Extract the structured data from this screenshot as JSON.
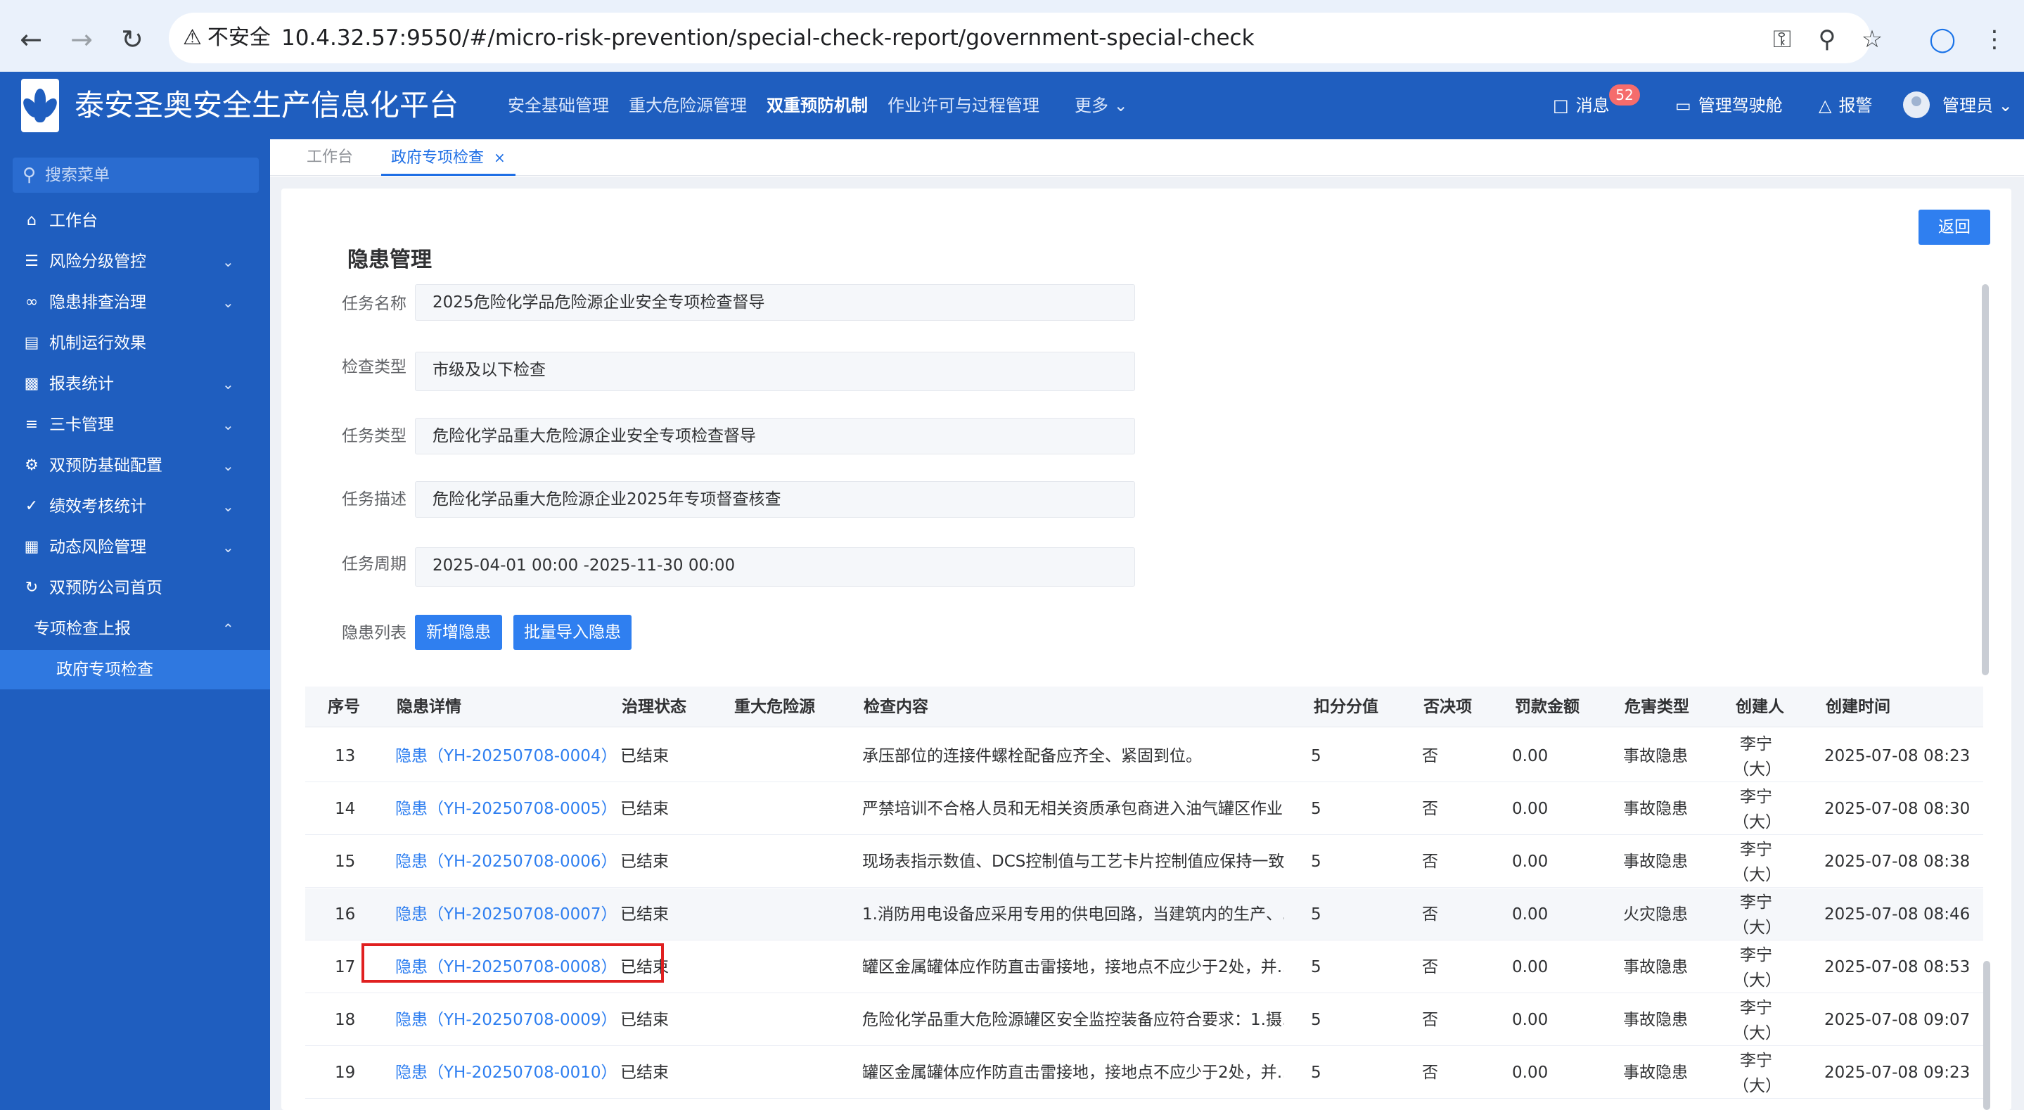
{
  "browser": {
    "security_label": "不安全",
    "url": "10.4.32.57:9550/#/micro-risk-prevention/special-check-report/government-special-check"
  },
  "app": {
    "title": "泰安圣奥安全生产信息化平台",
    "top_menu": [
      "安全基础管理",
      "重大危险源管理",
      "双重预防机制",
      "作业许可与过程管理",
      "更多"
    ],
    "active_top_menu": "双重预防机制",
    "messages_label": "消息",
    "messages_count": "52",
    "cockpit_label": "管理驾驶舱",
    "alarm_label": "报警",
    "user_label": "管理员"
  },
  "sidebar": {
    "search_placeholder": "搜索菜单",
    "items": [
      {
        "label": "工作台",
        "icon": "home-icon",
        "expandable": false
      },
      {
        "label": "风险分级管控",
        "icon": "risk-icon",
        "expandable": true
      },
      {
        "label": "隐患排查治理",
        "icon": "glasses-icon",
        "expandable": true
      },
      {
        "label": "机制运行效果",
        "icon": "bar-chart-icon",
        "expandable": false
      },
      {
        "label": "报表统计",
        "icon": "stats-icon",
        "expandable": true
      },
      {
        "label": "三卡管理",
        "icon": "list-icon",
        "expandable": true
      },
      {
        "label": "双预防基础配置",
        "icon": "gear-icon",
        "expandable": true
      },
      {
        "label": "绩效考核统计",
        "icon": "check-circle-icon",
        "expandable": true
      },
      {
        "label": "动态风险管理",
        "icon": "chart-icon",
        "expandable": true
      },
      {
        "label": "双预防公司首页",
        "icon": "refresh-icon",
        "expandable": false
      }
    ],
    "open_group": "专项检查上报",
    "active_sub_item": "政府专项检查"
  },
  "tabs": [
    {
      "label": "工作台",
      "active": false
    },
    {
      "label": "政府专项检查",
      "active": true
    }
  ],
  "page": {
    "back_label": "返回",
    "section_title": "隐患管理",
    "fields": [
      {
        "label": "任务名称",
        "value": "2025危险化学品危险源企业安全专项检查督导"
      },
      {
        "label": "检查类型",
        "value": "市级及以下检查"
      },
      {
        "label": "任务类型",
        "value": "危险化学品重大危险源企业安全专项检查督导"
      },
      {
        "label": "任务描述",
        "value": "危险化学品重大危险源企业2025年专项督查核查"
      },
      {
        "label": "任务周期",
        "value": "2025-04-01 00:00 -2025-11-30 00:00"
      }
    ],
    "list_label": "隐患列表",
    "add_button": "新增隐患",
    "import_button": "批量导入隐患"
  },
  "table": {
    "columns": [
      "序号",
      "隐患详情",
      "治理状态",
      "重大危险源",
      "检查内容",
      "扣分分值",
      "否决项",
      "罚款金额",
      "危害类型",
      "创建人",
      "创建时间"
    ],
    "rows": [
      {
        "no": "13",
        "detail": "隐患（YH-20250708-0004）",
        "status": "已结束",
        "major": "",
        "content": "承压部位的连接件螺栓配备应齐全、紧固到位。",
        "score": "5",
        "veto": "否",
        "fine": "0.00",
        "type": "事故隐患",
        "creator1": "李宁",
        "creator2": "（大）",
        "time": "2025-07-08 08:23"
      },
      {
        "no": "14",
        "detail": "隐患（YH-20250708-0005）",
        "status": "已结束",
        "major": "",
        "content": "严禁培训不合格人员和无相关资质承包商进入油气罐区作业…",
        "score": "5",
        "veto": "否",
        "fine": "0.00",
        "type": "事故隐患",
        "creator1": "李宁",
        "creator2": "（大）",
        "time": "2025-07-08 08:30"
      },
      {
        "no": "15",
        "detail": "隐患（YH-20250708-0006）",
        "status": "已结束",
        "major": "",
        "content": "现场表指示数值、DCS控制值与工艺卡片控制值应保持一致。",
        "score": "5",
        "veto": "否",
        "fine": "0.00",
        "type": "事故隐患",
        "creator1": "李宁",
        "creator2": "（大）",
        "time": "2025-07-08 08:38"
      },
      {
        "no": "16",
        "detail": "隐患（YH-20250708-0007）",
        "status": "已结束",
        "major": "",
        "content": "1.消防用电设备应采用专用的供电回路，当建筑内的生产、…",
        "score": "5",
        "veto": "否",
        "fine": "0.00",
        "type": "火灾隐患",
        "creator1": "李宁",
        "creator2": "（大）",
        "time": "2025-07-08 08:46"
      },
      {
        "no": "17",
        "detail": "隐患（YH-20250708-0008）",
        "status": "已结束",
        "major": "",
        "content": "罐区金属罐体应作防直击雷接地，接地点不应少于2处，并…",
        "score": "5",
        "veto": "否",
        "fine": "0.00",
        "type": "事故隐患",
        "creator1": "李宁",
        "creator2": "（大）",
        "time": "2025-07-08 08:53"
      },
      {
        "no": "18",
        "detail": "隐患（YH-20250708-0009）",
        "status": "已结束",
        "major": "",
        "content": "危险化学品重大危险源罐区安全监控装备应符合要求：1.摄…",
        "score": "5",
        "veto": "否",
        "fine": "0.00",
        "type": "事故隐患",
        "creator1": "李宁",
        "creator2": "（大）",
        "time": "2025-07-08 09:07"
      },
      {
        "no": "19",
        "detail": "隐患（YH-20250708-0010）",
        "status": "已结束",
        "major": "",
        "content": "罐区金属罐体应作防直击雷接地，接地点不应少于2处，并…",
        "score": "5",
        "veto": "否",
        "fine": "0.00",
        "type": "事故隐患",
        "creator1": "李宁",
        "creator2": "（大）",
        "time": "2025-07-08 09:23"
      }
    ]
  },
  "colors": {
    "brand_blue": "#1f5ebf",
    "primary_button": "#2f7ff0",
    "link": "#2f7ff0",
    "highlight_border": "#e02020"
  }
}
